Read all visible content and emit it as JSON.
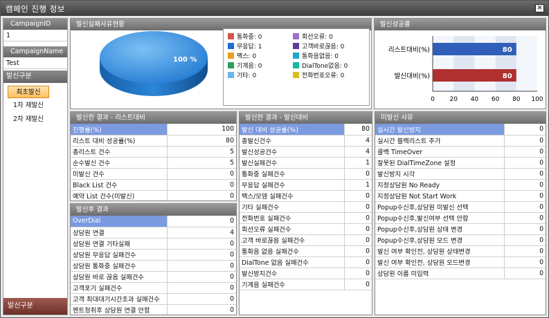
{
  "window": {
    "title": "캠페인 진행 정보",
    "close": "✕"
  },
  "left": {
    "campaign_id_label": "CampaignID",
    "campaign_id": "1",
    "campaign_name_label": "CampaignName",
    "campaign_name": "Test",
    "group_title": "발신구분",
    "groups": [
      "최초발신",
      "1차 재발신",
      "2차 재발신"
    ],
    "footer": "발신구분"
  },
  "fail_reason": {
    "title": "발신실패사유현황",
    "pie_label": "100 %",
    "legend": [
      {
        "label": "통화중: 0",
        "color": "#d9534f"
      },
      {
        "label": "회선오류: 0",
        "color": "#9b6fc9"
      },
      {
        "label": "무응답: 1",
        "color": "#1f6fd0"
      },
      {
        "label": "고객바로끊음: 0",
        "color": "#5e3d99"
      },
      {
        "label": "팩스: 0",
        "color": "#e8a020"
      },
      {
        "label": "통화음없음: 0",
        "color": "#1aa7c9"
      },
      {
        "label": "기계음: 0",
        "color": "#2ca05a"
      },
      {
        "label": "DialTone없음: 0",
        "color": "#15b8a0"
      },
      {
        "label": "기타: 0",
        "color": "#6ab6ee"
      },
      {
        "label": "전화번호오류: 0",
        "color": "#d6c020"
      }
    ]
  },
  "chart_data": {
    "type": "bar",
    "title": "발신성공률",
    "categories": [
      "리스트대비(%)",
      "발신대비(%)"
    ],
    "values": [
      80,
      80
    ],
    "xlim": [
      0,
      100
    ],
    "ticks": [
      "0",
      "20",
      "40",
      "60",
      "80",
      "100"
    ],
    "colors": [
      "#2f5fb8",
      "#b03030"
    ]
  },
  "list_result": {
    "title": "발신한 결과 - 리스트대비",
    "rows": [
      {
        "k": "진행률(%)",
        "v": "100"
      },
      {
        "k": "리스트 대비 성공률(%)",
        "v": "80"
      },
      {
        "k": "총리스트 건수",
        "v": "5"
      },
      {
        "k": "순수발신 건수",
        "v": "5"
      },
      {
        "k": "미발신 건수",
        "v": "0"
      },
      {
        "k": "Black List 건수",
        "v": "0"
      },
      {
        "k": "예약 List 건수(미발신)",
        "v": "0"
      }
    ]
  },
  "after_result": {
    "title": "발신후 결과",
    "rows": [
      {
        "k": "OverDial",
        "v": "0"
      },
      {
        "k": "상담원 연결",
        "v": "4"
      },
      {
        "k": "상담원 연결 기타실패",
        "v": "0"
      },
      {
        "k": "상담원 무응답 실패건수",
        "v": "0"
      },
      {
        "k": "상담원 통화중 실패건수",
        "v": "0"
      },
      {
        "k": "상담원 바로 끊음 실패건수",
        "v": "0"
      },
      {
        "k": "고객포기 실패건수",
        "v": "0"
      },
      {
        "k": "고객 최대대기시간초과 실패건수",
        "v": "0"
      },
      {
        "k": "멘트청취후 상담원 연결 안함",
        "v": "0"
      }
    ]
  },
  "call_result": {
    "title": "발신한 결과 - 발신대비",
    "rows": [
      {
        "k": "발신 대비 성공률(%)",
        "v": "80"
      },
      {
        "k": "총발신건수",
        "v": "4"
      },
      {
        "k": "발신성공건수",
        "v": "4"
      },
      {
        "k": "발신실패건수",
        "v": "1"
      },
      {
        "k": "통화중 실패건수",
        "v": "0"
      },
      {
        "k": "무응답 실패건수",
        "v": "1"
      },
      {
        "k": "팩스/모뎀 실패건수",
        "v": "0"
      },
      {
        "k": "기타 실패건수",
        "v": "0"
      },
      {
        "k": "전화번호 실패건수",
        "v": "0"
      },
      {
        "k": "회선오류 실패건수",
        "v": "0"
      },
      {
        "k": "고객 바로끊음 실패건수",
        "v": "0"
      },
      {
        "k": "통화음 없음 실패건수",
        "v": "0"
      },
      {
        "k": "DialTone 없음 실패건수",
        "v": "0"
      },
      {
        "k": "발신방지건수",
        "v": "0"
      },
      {
        "k": "기계음 실패건수",
        "v": "0"
      }
    ]
  },
  "not_sent": {
    "title": "미발신 사유",
    "rows": [
      {
        "k": "실시간 발신방지",
        "v": "0"
      },
      {
        "k": "실시간 블랙리스트 추가",
        "v": "0"
      },
      {
        "k": "콜백 TimeOver",
        "v": "0"
      },
      {
        "k": "잘못된 DialTimeZone 설정",
        "v": "0"
      },
      {
        "k": "발신방지 시각",
        "v": "0"
      },
      {
        "k": "지정상담원 No Ready",
        "v": "0"
      },
      {
        "k": "지정상담원 Not Start Work",
        "v": "0"
      },
      {
        "k": "Popup수신후,상담원 미발신 선택",
        "v": "0"
      },
      {
        "k": "Popup수신후,발신여부 선택 안함",
        "v": "0"
      },
      {
        "k": "Popup수신후,상담원 상태 변경",
        "v": "0"
      },
      {
        "k": "Popup수신후,상담원 모드 변경",
        "v": "0"
      },
      {
        "k": "발신 여부 확인전, 상담원 상태변경",
        "v": "0"
      },
      {
        "k": "발신 여부 확인전, 상담원 모드변경",
        "v": "0"
      },
      {
        "k": "상담원 이름 미입력",
        "v": "0"
      }
    ]
  }
}
